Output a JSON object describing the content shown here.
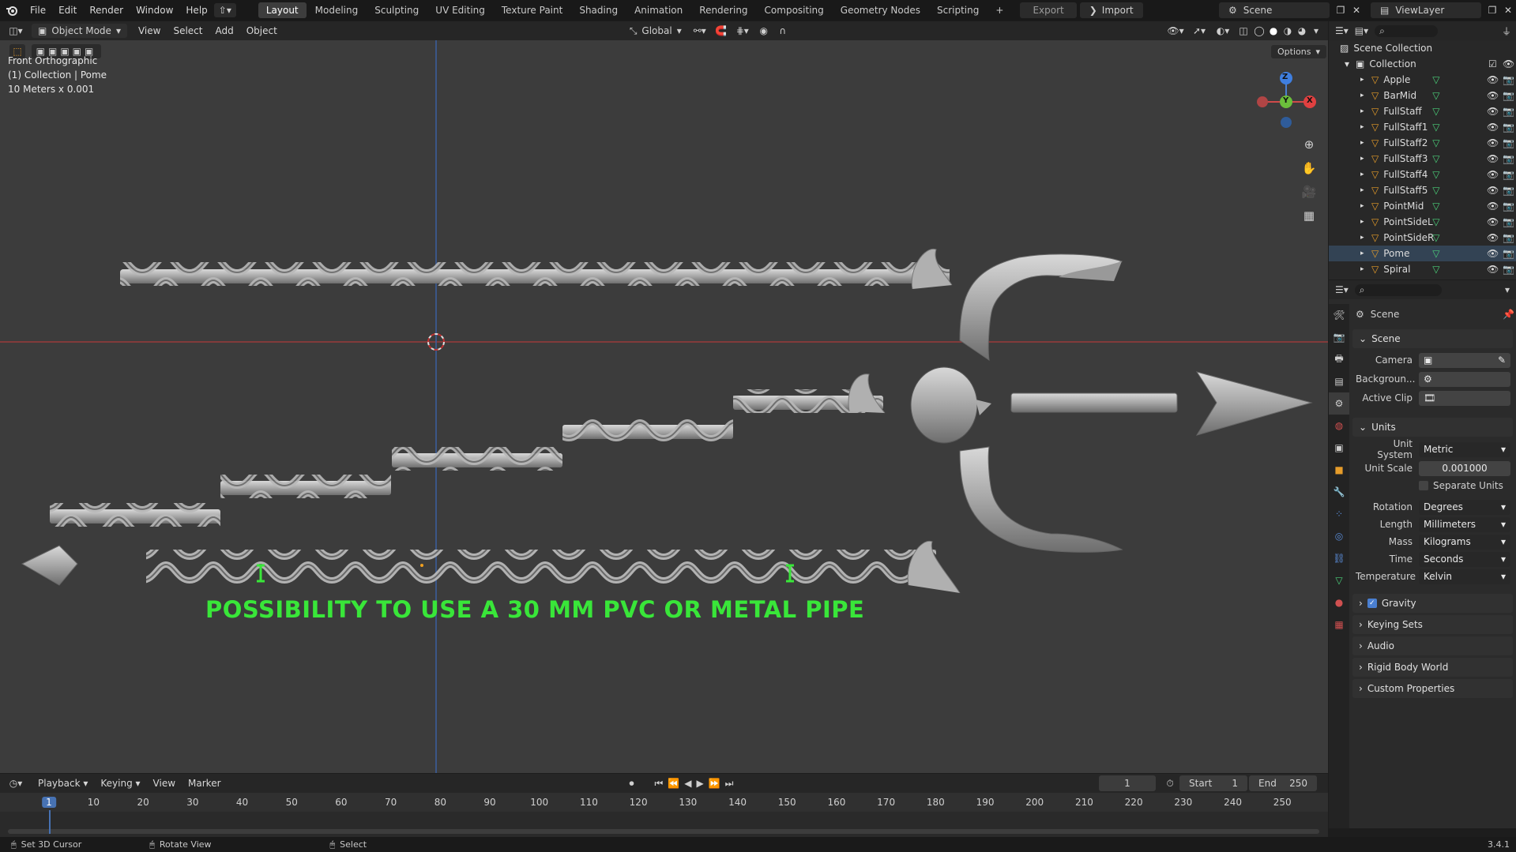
{
  "topbar": {
    "menus": [
      "File",
      "Edit",
      "Render",
      "Window",
      "Help"
    ],
    "workspaces": [
      "Layout",
      "Modeling",
      "Sculpting",
      "UV Editing",
      "Texture Paint",
      "Shading",
      "Animation",
      "Rendering",
      "Compositing",
      "Geometry Nodes",
      "Scripting"
    ],
    "active_workspace": "Layout",
    "export_label": "Export",
    "import_label": "Import",
    "scene_name": "Scene",
    "viewlayer_name": "ViewLayer"
  },
  "viewport_header": {
    "mode": "Object Mode",
    "menus": [
      "View",
      "Select",
      "Add",
      "Object"
    ],
    "orientation": "Global",
    "options_label": "Options"
  },
  "viewport": {
    "view_name": "Front Orthographic",
    "collection_info": "(1) Collection | Pome",
    "scale_info": "10 Meters x 0.001",
    "annotation": "POSSIBILITY TO USE A 30 MM PVC OR METAL PIPE",
    "annotation_color": "#39e639",
    "gizmo": {
      "z": "Z",
      "y": "Y",
      "x": "X"
    }
  },
  "outliner": {
    "root": "Scene Collection",
    "collection": "Collection",
    "items": [
      "Apple",
      "BarMid",
      "FullStaff",
      "FullStaff1",
      "FullStaff2",
      "FullStaff3",
      "FullStaff4",
      "FullStaff5",
      "PointMid",
      "PointSideL",
      "PointSideR",
      "Pome",
      "Spiral"
    ]
  },
  "properties": {
    "breadcrumb": "Scene",
    "scene_section": "Scene",
    "camera_label": "Camera",
    "background_label": "Backgroun...",
    "active_clip_label": "Active Clip",
    "units_section": "Units",
    "unit_system_label": "Unit System",
    "unit_system": "Metric",
    "unit_scale_label": "Unit Scale",
    "unit_scale": "0.001000",
    "separate_units": "Separate Units",
    "rotation_label": "Rotation",
    "rotation": "Degrees",
    "length_label": "Length",
    "length": "Millimeters",
    "mass_label": "Mass",
    "mass": "Kilograms",
    "time_label": "Time",
    "time": "Seconds",
    "temperature_label": "Temperature",
    "temperature": "Kelvin",
    "gravity": "Gravity",
    "keying_sets": "Keying Sets",
    "audio": "Audio",
    "rigid_body": "Rigid Body World",
    "custom_props": "Custom Properties"
  },
  "timeline": {
    "menus": [
      "Playback",
      "Keying",
      "View",
      "Marker"
    ],
    "current_frame": "1",
    "start_label": "Start",
    "start": "1",
    "end_label": "End",
    "end": "250",
    "ticks": [
      "1",
      "10",
      "20",
      "30",
      "40",
      "50",
      "60",
      "70",
      "80",
      "90",
      "100",
      "110",
      "120",
      "130",
      "140",
      "150",
      "160",
      "170",
      "180",
      "190",
      "200",
      "210",
      "220",
      "230",
      "240",
      "250"
    ]
  },
  "statusbar": {
    "hint1": "Set 3D Cursor",
    "hint2": "Rotate View",
    "hint3": "Select",
    "version": "3.4.1"
  }
}
